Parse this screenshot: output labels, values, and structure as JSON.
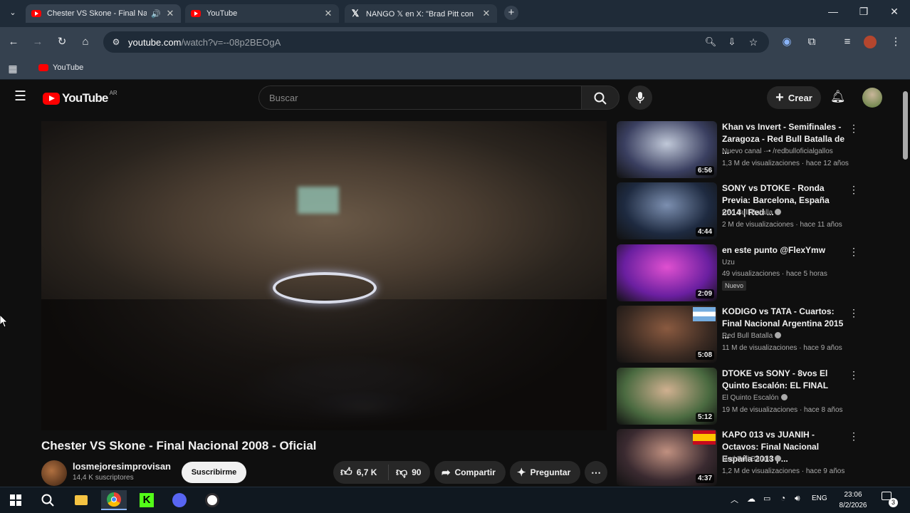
{
  "browser": {
    "tabs": [
      {
        "title": "Chester VS Skone - Final Nacional",
        "icon": "youtube-icon",
        "audio": true
      },
      {
        "title": "YouTube",
        "icon": "youtube-icon",
        "audio": false
      },
      {
        "title": "NANGO 𝕏 en X: \"Brad Pitt con",
        "icon": "x-icon",
        "audio": false
      }
    ],
    "address": {
      "host": "youtube.com",
      "path": "/watch?v=--08p2BEOgA"
    },
    "bookmarks": [
      {
        "label": "YouTube",
        "icon": "youtube-icon"
      }
    ]
  },
  "youtube": {
    "logo_text": "YouTube",
    "region": "AR",
    "search_placeholder": "Buscar",
    "create_label": "Crear"
  },
  "video": {
    "title": "Chester VS Skone - Final Nacional 2008 - Oficial",
    "channel": "losmejoresimprovisan",
    "subscribers": "14,4 K suscriptores",
    "subscribe_label": "Suscribirme",
    "likes": "6,7 K",
    "dislikes": "90",
    "share_label": "Compartir",
    "ask_label": "Preguntar"
  },
  "recommendations": [
    {
      "title": "Khan vs Invert - Semifinales - Zaragoza - Red Bull Batalla de ...",
      "channel": "Nuevo canal ·-• /redbulloficialgallos",
      "verified": false,
      "meta": "1,3 M de visualizaciones · hace 12 años",
      "duration": "6:56",
      "badge": "",
      "flag": "",
      "colors": [
        "#3a3f60",
        "#c0c8d8"
      ]
    },
    {
      "title": "SONY vs DTOKE - Ronda Previa: Barcelona, España 2014 | Red ...",
      "channel": "Red Bull Batalla",
      "verified": true,
      "meta": "2 M de visualizaciones · hace 11 años",
      "duration": "4:44",
      "badge": "",
      "flag": "",
      "colors": [
        "#1e2a40",
        "#7c8fb0"
      ]
    },
    {
      "title": "en este punto @FlexYmw",
      "channel": "Uzu",
      "verified": false,
      "meta": "49 visualizaciones · hace 5 horas",
      "duration": "2:09",
      "badge": "Nuevo",
      "flag": "",
      "colors": [
        "#6a1fa0",
        "#e050d0"
      ]
    },
    {
      "title": "KODIGO vs TATA - Cuartos: Final Nacional Argentina 2015 ...",
      "channel": "Red Bull Batalla",
      "verified": true,
      "meta": "11 M de visualizaciones · hace 9 años",
      "duration": "5:08",
      "badge": "",
      "flag": "argentina",
      "colors": [
        "#3a2a22",
        "#8a5a40"
      ]
    },
    {
      "title": "DTOKE vs SONY - 8vos El Quinto Escalón: EL FINAL",
      "channel": "El Quinto Escalón",
      "verified": true,
      "meta": "19 M de visualizaciones · hace 8 años",
      "duration": "5:12",
      "badge": "",
      "flag": "",
      "colors": [
        "#4a6a40",
        "#d0b090"
      ]
    },
    {
      "title": "KAPO 013 vs JUANIH - Octavos: Final Nacional España 2013 | ...",
      "channel": "Red Bull Batalla",
      "verified": true,
      "meta": "1,2 M de visualizaciones · hace 9 años",
      "duration": "4:37",
      "badge": "",
      "flag": "spain",
      "colors": [
        "#3a2a30",
        "#c09080"
      ]
    }
  ],
  "taskbar": {
    "language": "ENG",
    "time": "23:06",
    "date": "8/2/2026",
    "notifications": "3"
  }
}
